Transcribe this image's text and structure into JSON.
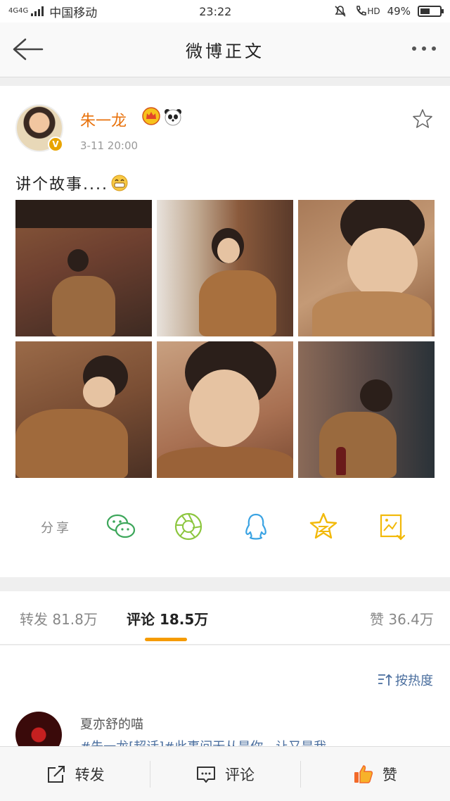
{
  "status_bar": {
    "network": "4G4G",
    "carrier": "中国移动",
    "time": "23:22",
    "hd_label": "HD",
    "battery": "49%",
    "battery_level": 0.49
  },
  "nav": {
    "title": "微博正文",
    "back_icon": "arrow-left-icon",
    "more_icon": "more-dots-icon"
  },
  "post": {
    "author": "朱一龙",
    "time": "3-11 20:00",
    "verified_badge": "V",
    "text": "讲个故事....",
    "badges": [
      "crown-icon",
      "panda-icon"
    ],
    "photos": 6
  },
  "share": {
    "label": "分享",
    "targets": [
      "wechat-icon",
      "moments-icon",
      "qq-icon",
      "qzone-icon",
      "save-image-icon"
    ]
  },
  "tabs": {
    "repost": "转发 81.8万",
    "comment": "评论 18.5万",
    "like": "赞 36.4万"
  },
  "comments": {
    "sort_label": "按热度",
    "first_name": "夏亦舒的喵",
    "first_text": "#朱一龙[超话]#此事间无从是你，让又是我"
  },
  "bottom_bar": {
    "repost": "转发",
    "comment": "评论",
    "like": "赞"
  },
  "colors": {
    "accent": "#f59b00",
    "name": "#e8720c",
    "link": "#4a6e9e"
  }
}
